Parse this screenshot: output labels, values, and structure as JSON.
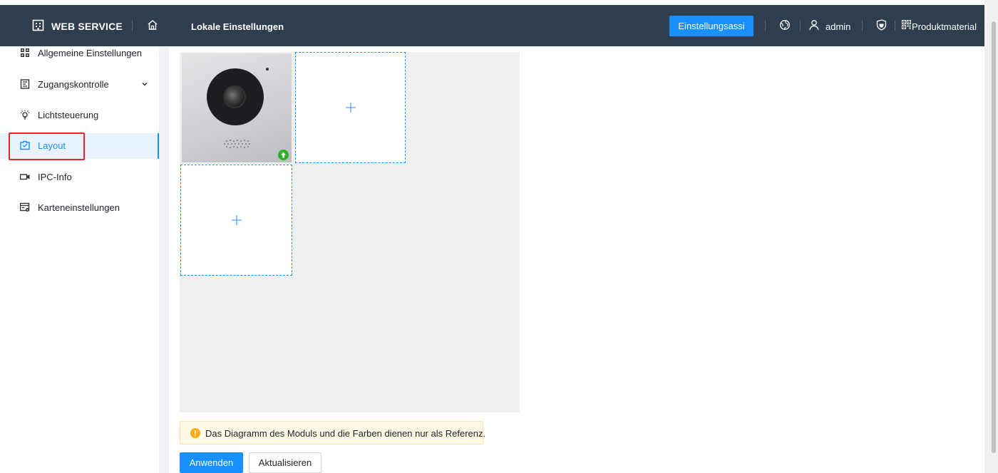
{
  "header": {
    "brand_title": "WEB SERVICE",
    "page_title": "Lokale Einstellungen",
    "wizard_button": "Einstellungsassi",
    "user_name": "admin",
    "product_material": "Produktmaterial"
  },
  "sidebar": {
    "items": [
      {
        "label": "Allgemeine Einstellungen",
        "icon": "grid-icon"
      },
      {
        "label": "Zugangskontrolle",
        "icon": "access-control-icon"
      },
      {
        "label": "Lichtsteuerung",
        "icon": "light-bulb-icon"
      },
      {
        "label": "Layout",
        "icon": "layout-icon"
      },
      {
        "label": "IPC-Info",
        "icon": "camera-icon"
      },
      {
        "label": "Karteneinstellungen",
        "icon": "card-settings-icon"
      }
    ],
    "active_item": "Layout"
  },
  "main": {
    "notice_text": "Das Diagramm des Moduls und die Farben dienen nur als Referenz.",
    "apply_button": "Anwenden",
    "refresh_button": "Aktualisieren"
  },
  "colors": {
    "header_bg": "#2f3e4e",
    "accent": "#1890ff",
    "notice_bg": "#fffbe6",
    "highlight": "#e02a2a",
    "upload_badge": "#2bb02b"
  }
}
